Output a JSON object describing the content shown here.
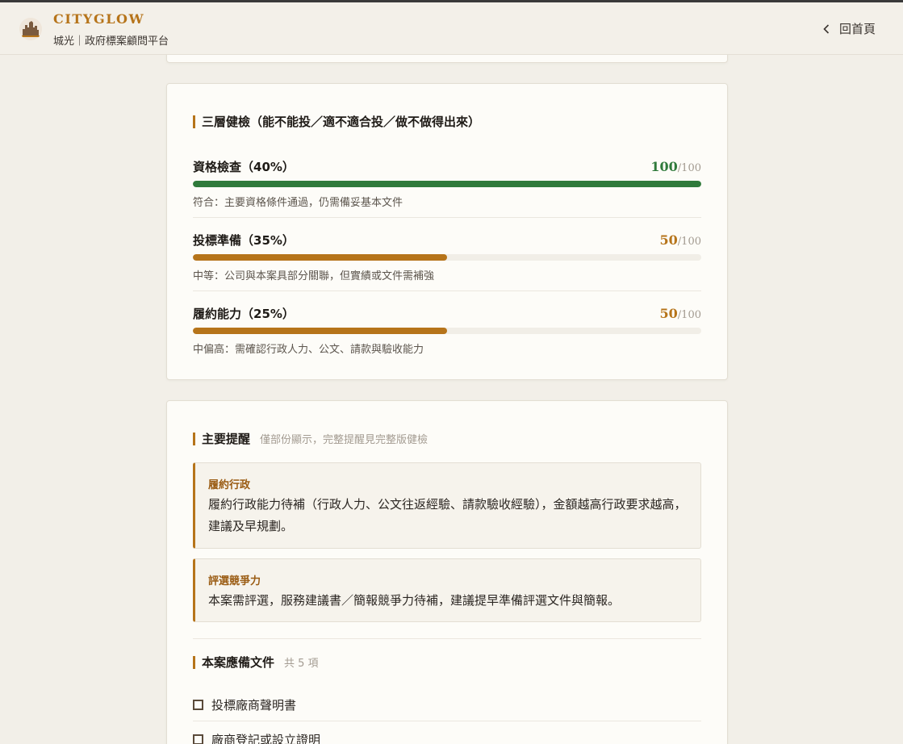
{
  "header": {
    "brand": "CITYGLOW",
    "subtitle": "城光｜政府標案顧問平台",
    "back_label": "回首頁"
  },
  "health_check": {
    "title": "三層健檢（能不能投／適不適合投／做不做得出來）",
    "metrics": [
      {
        "label": "資格檢查（40%）",
        "score": 100,
        "max": "/100",
        "desc": "符合：主要資格條件通過，仍需備妥基本文件",
        "color": "#2f7a3b"
      },
      {
        "label": "投標準備（35%）",
        "score": 50,
        "max": "/100",
        "desc": "中等：公司與本案具部分關聯，但實績或文件需補強",
        "color": "#b6741a"
      },
      {
        "label": "履約能力（25%）",
        "score": 50,
        "max": "/100",
        "desc": "中偏高：需確認行政人力、公文、請款與驗收能力",
        "color": "#b6741a"
      }
    ]
  },
  "reminders": {
    "title": "主要提醒",
    "note": "僅部份顯示，完整提醒見完整版健檢",
    "items": [
      {
        "title": "履約行政",
        "body": "履約行政能力待補（行政人力、公文往返經驗、請款驗收經驗），金額越高行政要求越高，建議及早規劃。"
      },
      {
        "title": "評選競爭力",
        "body": "本案需評選，服務建議書／簡報競爭力待補，建議提早準備評選文件與簡報。"
      }
    ]
  },
  "documents": {
    "title": "本案應備文件",
    "count_label": "共 5 項",
    "items": [
      "投標廠商聲明書",
      "廠商登記或設立證明"
    ]
  },
  "colors": {
    "accent": "#b6741a",
    "success": "#2f7a3b",
    "background": "#f2efe8"
  }
}
